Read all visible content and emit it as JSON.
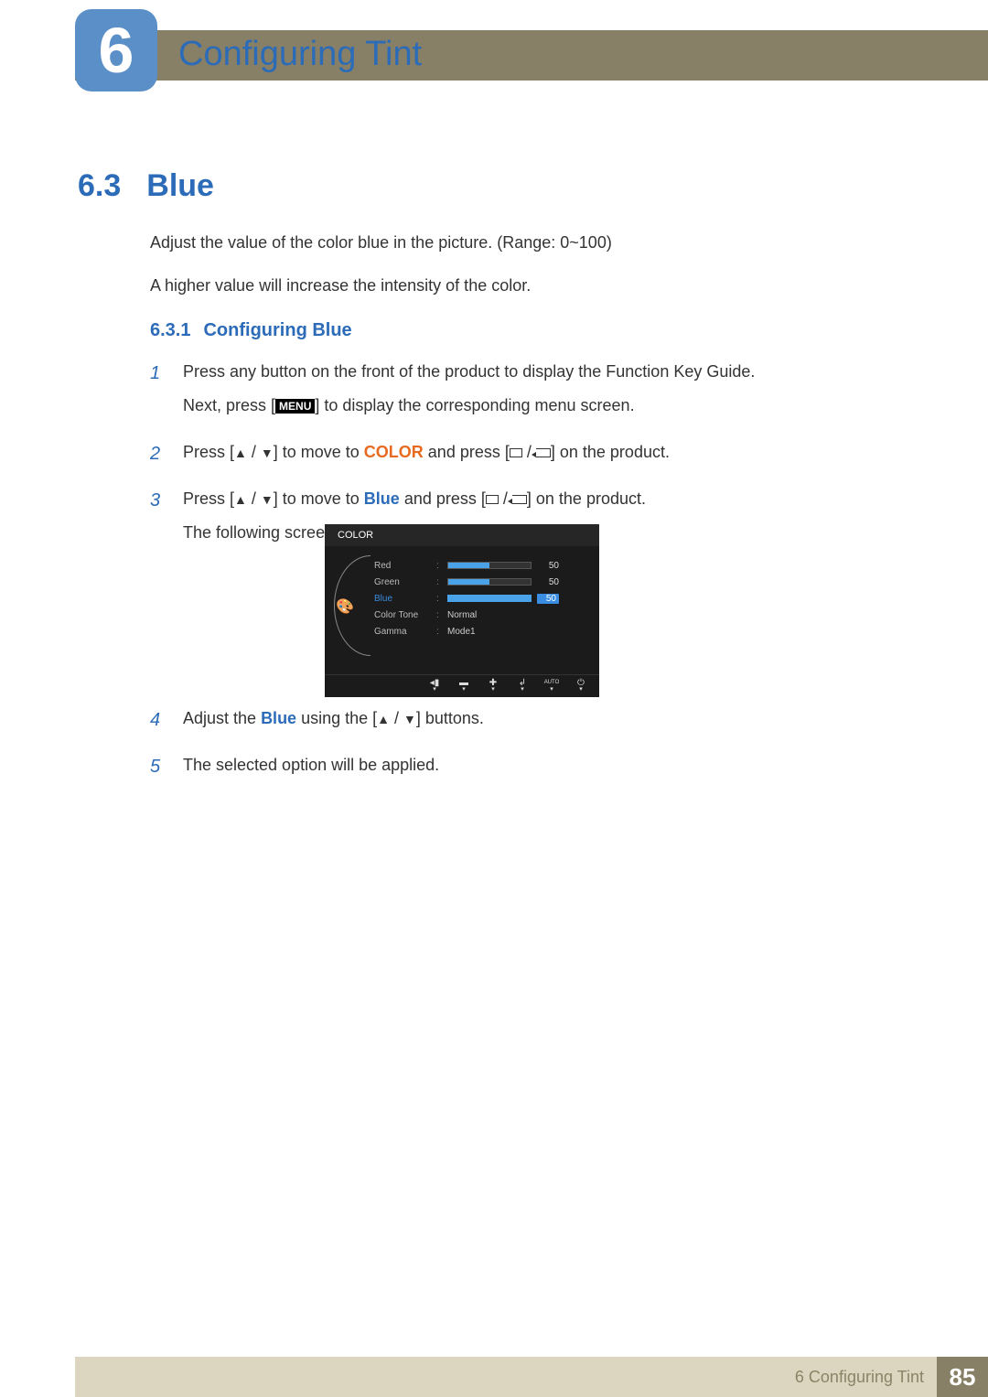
{
  "header": {
    "chapter_number": "6",
    "chapter_title": "Configuring Tint"
  },
  "section": {
    "number": "6.3",
    "title": "Blue",
    "paragraph1": "Adjust the value of the color blue in the picture. (Range: 0~100)",
    "paragraph2": "A higher value will increase the intensity of the color."
  },
  "subsection": {
    "number": "6.3.1",
    "title": "Configuring Blue"
  },
  "steps": {
    "s1_a": "Press any button on the front of the product to display the Function Key Guide.",
    "s1_b_pre": "Next, press [",
    "s1_b_menu": "MENU",
    "s1_b_post": "] to display the corresponding menu screen.",
    "s2_pre": "Press [",
    "s2_mid": "] to move to ",
    "s2_color": "COLOR",
    "s2_and": " and press [",
    "s2_post": "] on the product.",
    "s3_pre": "Press [",
    "s3_mid": "] to move to ",
    "s3_blue": "Blue",
    "s3_and": " and press [",
    "s3_post": "] on the product.",
    "s3_below": "The following screen will appear.",
    "s4_pre": "Adjust the ",
    "s4_blue": "Blue",
    "s4_mid": " using the [",
    "s4_post": "] buttons.",
    "s5": "The selected option will be applied.",
    "n1": "1",
    "n2": "2",
    "n3": "3",
    "n4": "4",
    "n5": "5"
  },
  "osd": {
    "title": "COLOR",
    "rows": {
      "red": {
        "label": "Red",
        "value": "50"
      },
      "green": {
        "label": "Green",
        "value": "50"
      },
      "blue": {
        "label": "Blue",
        "value": "50"
      },
      "tone": {
        "label": "Color Tone",
        "value": "Normal"
      },
      "gamma": {
        "label": "Gamma",
        "value": "Mode1"
      }
    },
    "footer": {
      "back": "◂▮",
      "minus": "▬",
      "plus": "✚",
      "enter": "↲",
      "auto": "AUTO",
      "power": "⏻",
      "caret": "▾"
    }
  },
  "footer": {
    "chapter_label": "6 Configuring Tint",
    "page_number": "85"
  }
}
